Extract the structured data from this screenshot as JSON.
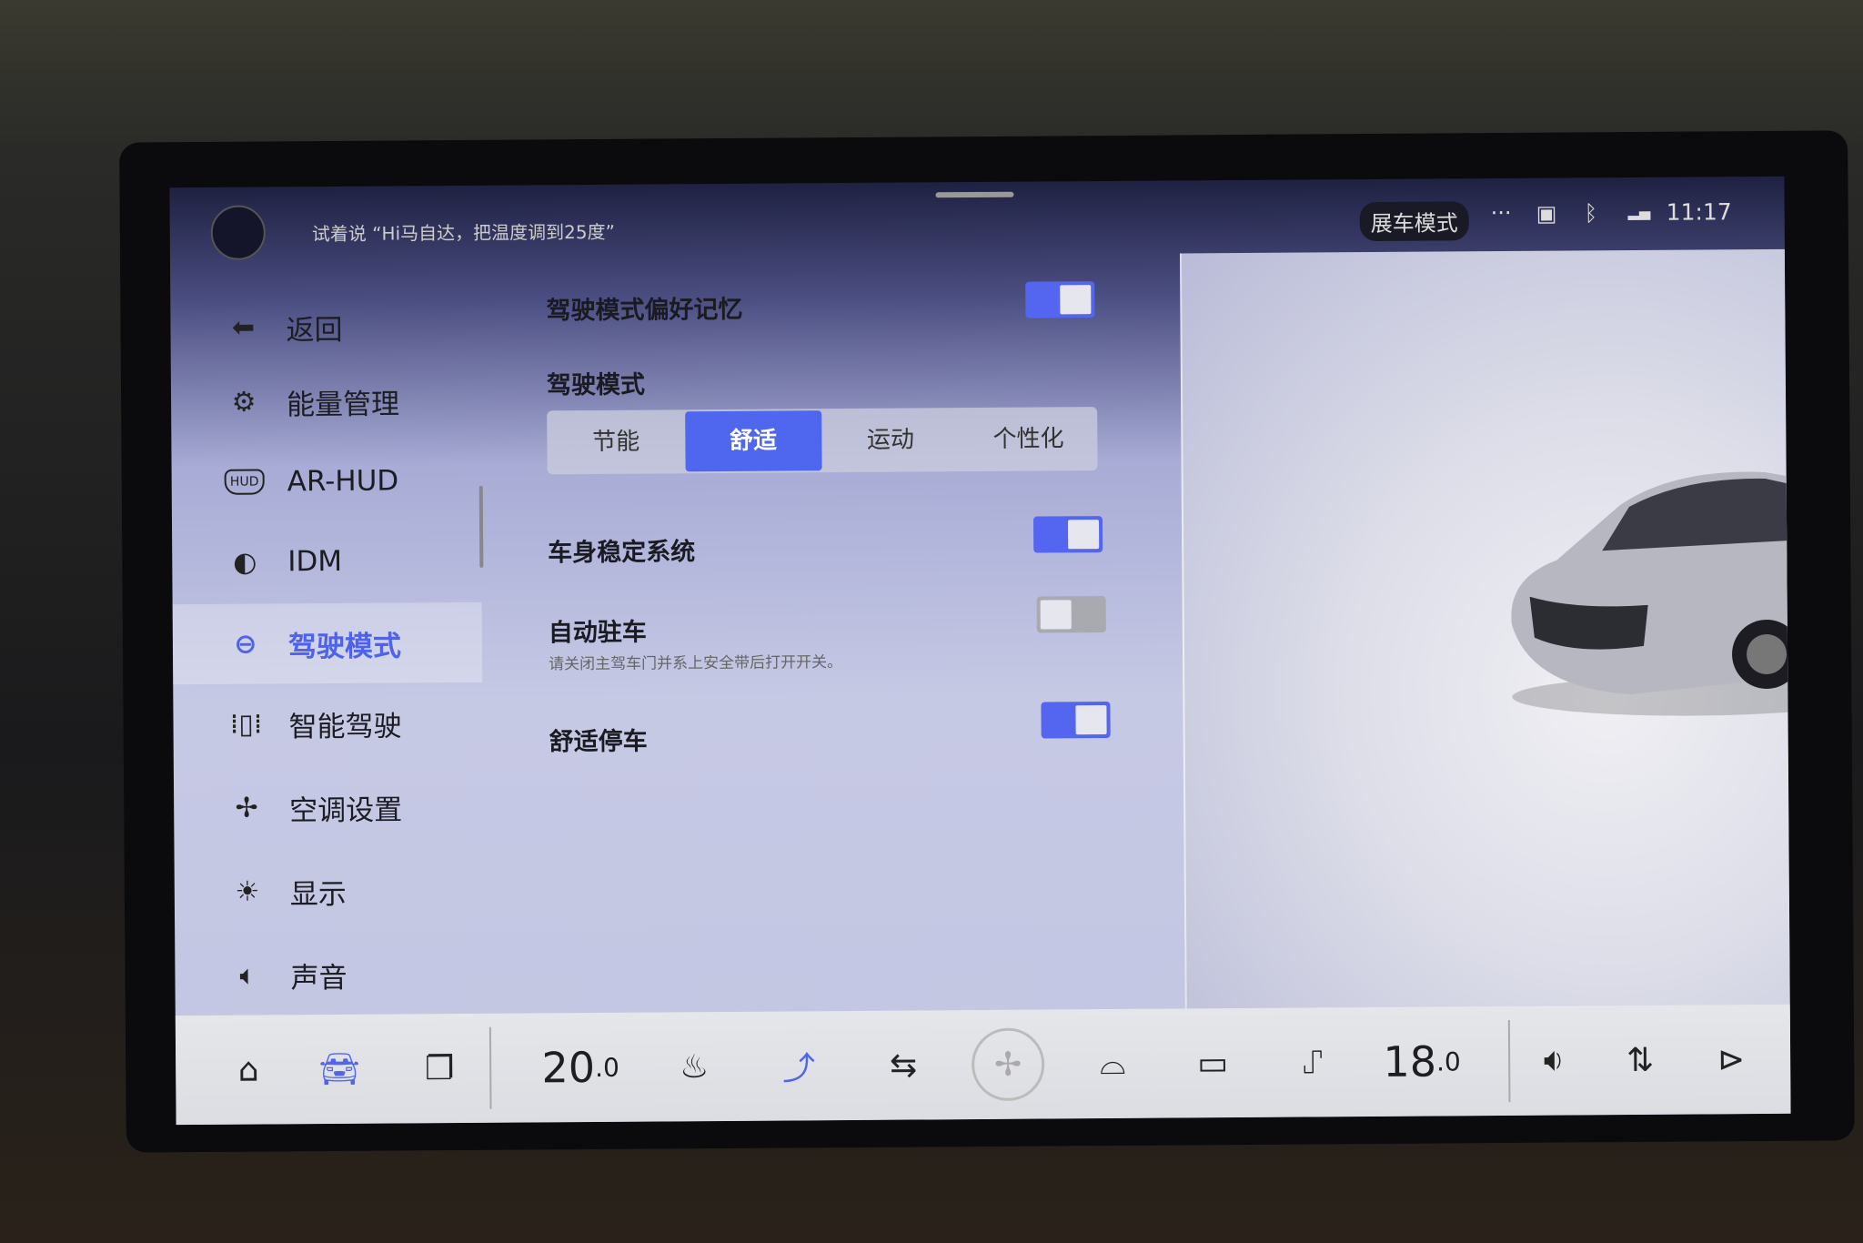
{
  "topbar": {
    "voice_prompt": "试着说 “Hi马自达，把温度调到25度”",
    "showroom_mode": "展车模式",
    "more": "···",
    "time": "11:17",
    "icons": [
      "microphone-orb-icon",
      "more-icon",
      "camera-icon",
      "bluetooth-icon",
      "signal-icon"
    ]
  },
  "sidebar": {
    "items": [
      {
        "label": "返回",
        "icon": "back-arrow-icon"
      },
      {
        "label": "能量管理",
        "icon": "energy-gear-icon"
      },
      {
        "label": "AR-HUD",
        "icon": "hud-icon"
      },
      {
        "label": "IDM",
        "icon": "idm-icon"
      },
      {
        "label": "驾驶模式",
        "icon": "steering-wheel-icon",
        "selected": true
      },
      {
        "label": "智能驾驶",
        "icon": "lane-assist-icon"
      },
      {
        "label": "空调设置",
        "icon": "fan-icon"
      },
      {
        "label": "显示",
        "icon": "brightness-icon"
      },
      {
        "label": "声音",
        "icon": "speaker-icon"
      }
    ]
  },
  "main": {
    "memory": {
      "label": "驾驶模式偏好记忆",
      "on": true
    },
    "drive_mode": {
      "label": "驾驶模式",
      "options": [
        "节能",
        "舒适",
        "运动",
        "个性化"
      ],
      "selected": "舒适"
    },
    "stability": {
      "label": "车身稳定系统",
      "on": true
    },
    "auto_hold": {
      "label": "自动驻车",
      "hint": "请关闭主驾车门并系上安全带后打开开关。",
      "on": false
    },
    "comfort_stop": {
      "label": "舒适停车",
      "on": true
    }
  },
  "bottombar": {
    "driver_temp": "20",
    "driver_temp_dec": ".0",
    "passenger_temp": "18",
    "passenger_temp_dec": ".0"
  },
  "colors": {
    "accent": "#4f66ef",
    "toggle_off": "#a9a9b0"
  }
}
